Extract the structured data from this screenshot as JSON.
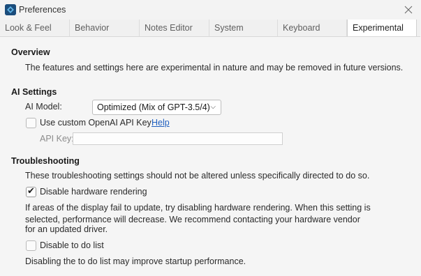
{
  "window": {
    "title": "Preferences"
  },
  "tabs": [
    {
      "label": "Look & Feel"
    },
    {
      "label": "Behavior"
    },
    {
      "label": "Notes Editor"
    },
    {
      "label": "System"
    },
    {
      "label": "Keyboard"
    },
    {
      "label": "Experimental",
      "active": true
    }
  ],
  "overview": {
    "heading": "Overview",
    "text": "The features and settings here are experimental in nature and may be removed in future versions."
  },
  "ai_settings": {
    "heading": "AI Settings",
    "model_label": "AI Model:",
    "model_value": "Optimized (Mix of GPT-3.5/4)",
    "custom_key_label": "Use custom OpenAI API Key",
    "custom_key_checked": false,
    "help_link": "Help",
    "api_key_label": "API Key:",
    "api_key_value": ""
  },
  "troubleshooting": {
    "heading": "Troubleshooting",
    "intro": "These troubleshooting settings should not be altered unless specifically directed to do so.",
    "hw_label": "Disable hardware rendering",
    "hw_checked": true,
    "hw_desc_line1": "If areas of the display fail to update, try disabling hardware rendering. When this setting is",
    "hw_desc_line2": "selected, performance will decrease. We recommend contacting your hardware vendor",
    "hw_desc_line3": "for an updated driver.",
    "todo_label": "Disable to do list",
    "todo_checked": false,
    "todo_desc": "Disabling the to do list may improve startup performance."
  },
  "colors": {
    "link": "#1f5fbf",
    "app_icon": "#1b4d7c"
  },
  "icons": {
    "app": "app-logo-icon",
    "close": "close-icon",
    "dropdown": "chevron-down-icon",
    "check": "checkmark-icon"
  }
}
